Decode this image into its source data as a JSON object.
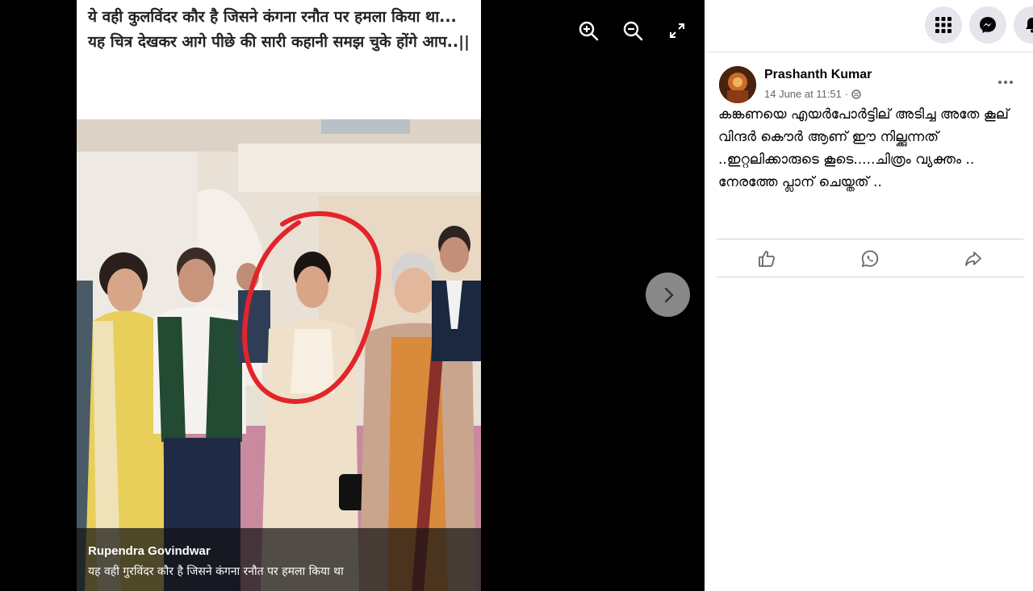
{
  "photo": {
    "caption_line1": "ये वही कुलविंदर कौर है जिसने कंगना रनौत पर हमला किया था...",
    "caption_line2": "यह चित्र देखकर आगे पीछे की सारी कहानी समझ चुके होंगे आप..||",
    "footer_name": "Rupendra Govindwar",
    "footer_text": "यह वही गुरविंदर कौर है जिसने कंगना रनौत पर हमला किया था"
  },
  "viewer": {
    "icons": [
      "zoom-in-icon",
      "zoom-out-icon",
      "fullscreen-icon",
      "chevron-right-icon"
    ]
  },
  "post": {
    "author": "Prashanth Kumar",
    "timestamp": "14 June at 11:51",
    "text": "കങ്കണയെ എയർപോർട്ടില് അടിച്ച അതേ കൂല് വിന്ദർ കൌർ ആണ് ഈ നില്ക്കുന്നത് ..ഇറ്റലിക്കാരുടെ കൂടെ.....ചിത്രം വ്യക്തം .. നേരത്തേ പ്ലാന് ചെയ്തത് .."
  },
  "topbar": {
    "icons": [
      "menu-grid-icon",
      "messenger-icon",
      "notifications-icon"
    ]
  },
  "colors": {
    "circle_annotation": "#e3242b",
    "background": "#000000",
    "sidebar": "#ffffff",
    "button_grey": "#e4e6eb"
  }
}
